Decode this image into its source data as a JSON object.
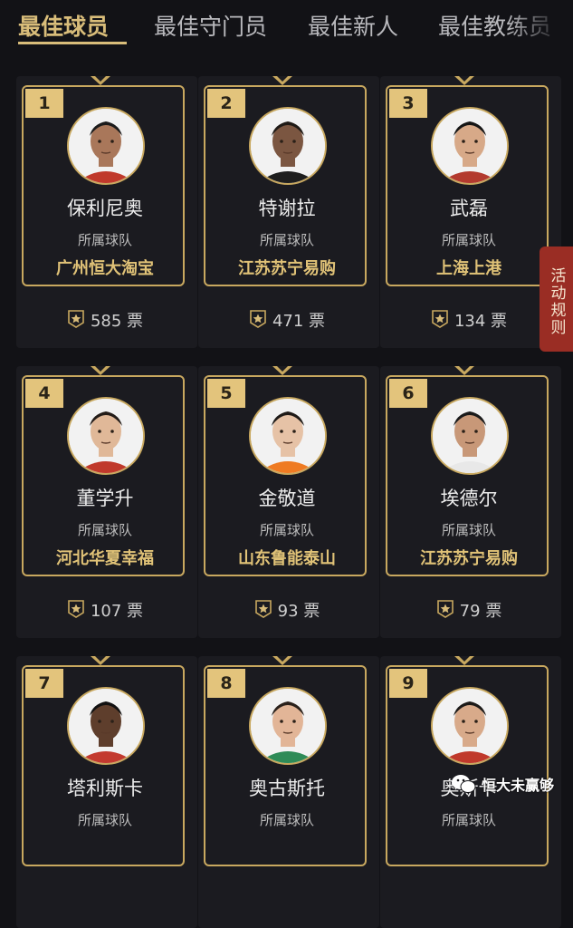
{
  "tabs": [
    "最佳球员",
    "最佳守门员",
    "最佳新人",
    "最佳教练员"
  ],
  "active_tab": 0,
  "team_label": "所属球队",
  "vote_unit": "票",
  "side_button": "活动规则",
  "watermark": "恒大未赢够",
  "colors": {
    "accent": "#d9bd7a",
    "badge": "#e3c47c",
    "side_button": "#9a2d24",
    "background": "#121216"
  },
  "players": [
    {
      "rank": "1",
      "name": "保利尼奥",
      "team": "广州恒大淘宝",
      "votes": "585"
    },
    {
      "rank": "2",
      "name": "特谢拉",
      "team": "江苏苏宁易购",
      "votes": "471"
    },
    {
      "rank": "3",
      "name": "武磊",
      "team": "上海上港",
      "votes": "134"
    },
    {
      "rank": "4",
      "name": "董学升",
      "team": "河北华夏幸福",
      "votes": "107"
    },
    {
      "rank": "5",
      "name": "金敬道",
      "team": "山东鲁能泰山",
      "votes": "93"
    },
    {
      "rank": "6",
      "name": "埃德尔",
      "team": "江苏苏宁易购",
      "votes": "79"
    },
    {
      "rank": "7",
      "name": "塔利斯卡",
      "team": "",
      "votes": ""
    },
    {
      "rank": "8",
      "name": "奥古斯托",
      "team": "",
      "votes": ""
    },
    {
      "rank": "9",
      "name": "奥斯卡",
      "team": "",
      "votes": ""
    }
  ]
}
